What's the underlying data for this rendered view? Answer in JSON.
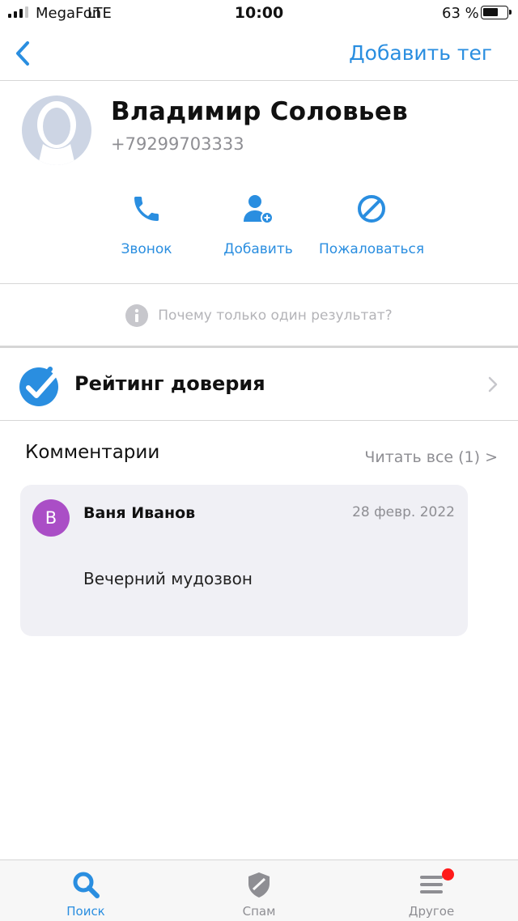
{
  "status_bar": {
    "carrier": "MegaFon",
    "network": "LTE",
    "time": "10:00",
    "battery": "63 %"
  },
  "nav": {
    "back_icon": "chevron-left-icon",
    "add_tag_label": "Добавить тег"
  },
  "contact": {
    "name": "Владимир Соловьев",
    "phone": "+79299703333",
    "avatar_icon": "person-silhouette-icon"
  },
  "actions": [
    {
      "label": "Звонок",
      "icon": "phone-icon"
    },
    {
      "label": "Добавить",
      "icon": "add-contact-icon"
    },
    {
      "label": "Пожаловаться",
      "icon": "block-icon"
    }
  ],
  "why_single_result": "Почему только один результат?",
  "rating": {
    "title": "Рейтинг доверия",
    "icon": "verified-check-icon"
  },
  "comments": {
    "title": "Комментарии",
    "read_all": "Читать все (1) >",
    "items": [
      {
        "avatar_letter": "В",
        "author": "Ваня Иванов",
        "date": "28 февр. 2022",
        "text": "Вечерний мудозвон"
      }
    ]
  },
  "tabs": [
    {
      "label": "Поиск",
      "icon": "search-icon",
      "active": true
    },
    {
      "label": "Спам",
      "icon": "shield-icon",
      "active": false
    },
    {
      "label": "Другое",
      "icon": "menu-icon",
      "active": false,
      "badge": true
    }
  ],
  "colors": {
    "accent": "#2a8ee0",
    "comment_avatar": "#aa4ec6",
    "badge": "#ff1a1a"
  }
}
